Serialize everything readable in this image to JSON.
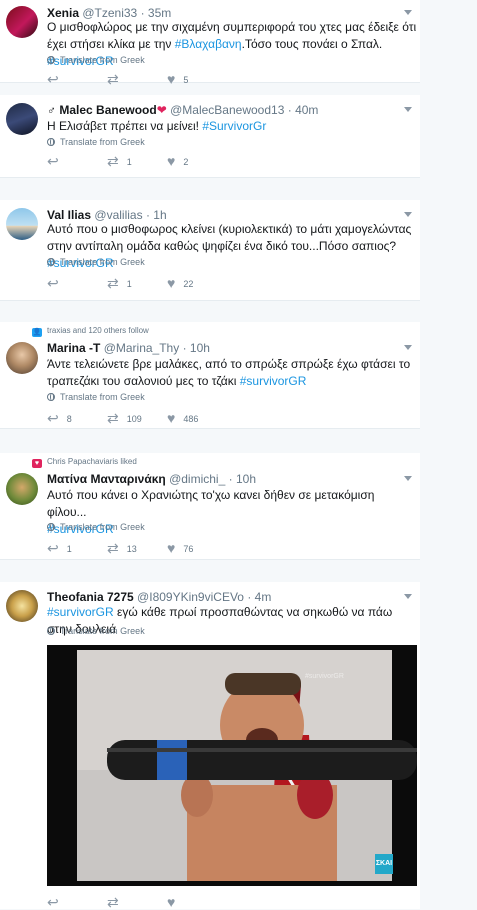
{
  "translate_label": "Translate from Greek",
  "colors": {
    "link": "#1b95e0",
    "like": "#8b98a5",
    "retweet": "#8b98a5"
  },
  "tweets": [
    {
      "name": "Xenia",
      "handle": "@Tzeni33",
      "time": "35m",
      "body_1": "Ο μισθοφλώρος με την σιχαμένη συμπεριφορά του χτες μας έδειξε ότι   έχει στήσει κλίκα με την ",
      "hashtag_1": "#Βλαχαβανη",
      "body_2": ".Τόσο τους πονάει ο Σπαλ. ",
      "hashtag_2": "#survivorGR",
      "replies": "",
      "retweets": "",
      "likes": "5"
    },
    {
      "name": "Malec Banewood",
      "handle": "@MalecBanewood13",
      "time": "40m",
      "body_1": "Η Ελισάβετ πρέπει να μείνει! ",
      "hashtag_1": "#SurvivorGr",
      "replies": "",
      "retweets": "1",
      "likes": "2"
    },
    {
      "name": "Val Ilias",
      "handle": "@valilias",
      "time": "1h",
      "body_1": "Αυτό που ο μισθοφωρος κλείνει (κυριολεκτικά) το μάτι χαμογελώντας στην αντίπαλη ομάδα καθώς ψηφίζει ένα δικό του...Πόσο σαπιος?",
      "hashtag_1": "#survivorGR",
      "replies": "",
      "retweets": "1",
      "likes": "22"
    },
    {
      "social": "traxias and 120 others follow",
      "name": "Marina -T",
      "handle": "@Marina_Thy",
      "time": "10h",
      "body_1": "Άντε τελειώνετε βρε μαλάκες, από το σπρώξε σπρώξε έχω φτάσει το τραπεζάκι του σαλονιού μες το τζάκι ",
      "hashtag_1": "#survivorGR",
      "replies": "8",
      "retweets": "109",
      "likes": "486"
    },
    {
      "social": "Chris Papachaviaris liked",
      "name": "Ματίνα Μανταρινάκη",
      "handle": "@dimichi_",
      "time": "10h",
      "body_1": "Αυτό που κάνει ο Χρανιώτης το'χω κανει δήθεν σε μετακόμιση φίλου...",
      "hashtag_1": "#survivorGR",
      "replies": "1",
      "retweets": "13",
      "likes": "76"
    },
    {
      "name": "Theofania 7275",
      "handle": "@I809YKin9viCEVo",
      "time": "4m",
      "hashtag_1": "#survivorGR",
      "body_1": " εγώ κάθε πρωί προσπαθώντας να σηκωθώ να πάω στην δουλειά",
      "replies": "",
      "retweets": "",
      "likes": "",
      "media_logo": "ΣΚΑΙ",
      "media_watermark": "#survivorGR"
    }
  ]
}
